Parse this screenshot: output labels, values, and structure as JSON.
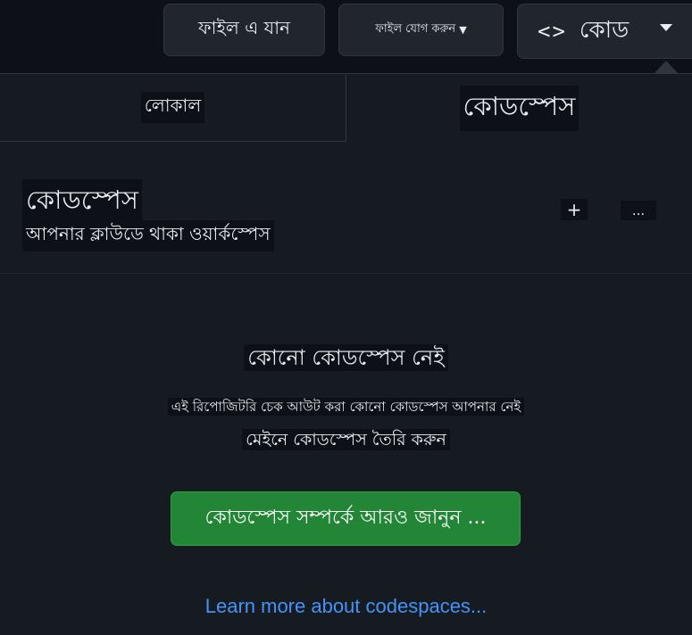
{
  "toolbar": {
    "goto_file_label": "ফাইল এ যান",
    "add_file_label": "ফাইল যোগ করুন",
    "code_label": "কোড",
    "code_icon": "code-icon"
  },
  "tabs": {
    "local_label": "লোকাল",
    "codespaces_label": "কোডস্পেস"
  },
  "section": {
    "title": "কোডস্পেস",
    "subtitle": "আপনার ক্লাউডে থাকা ওয়ার্কস্পেস",
    "add_symbol": "+",
    "more_symbol": "..."
  },
  "empty_state": {
    "title": "কোনো কোডস্পেস নেই",
    "description_line1": "এই রিপোজিটরি চেক আউট করা কোনো কোডস্পেস আপনার নেই",
    "description_line2": "মেইনে কোডস্পেস তৈরি করুন",
    "create_button_label": "কোডস্পেস সম্পর্কে আরও জানুন ...",
    "learn_more_link": "Learn more about codespaces..."
  },
  "colors": {
    "background": "#0d1117",
    "panel": "#161b22",
    "primary_button": "#238636",
    "link": "#4493f8"
  }
}
